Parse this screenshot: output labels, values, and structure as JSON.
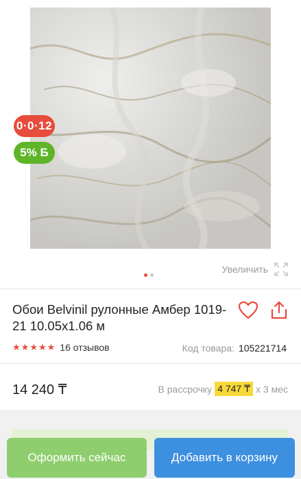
{
  "gallery": {
    "badge_installment": "0·0·12",
    "badge_bonus": "5% Б",
    "zoom_label": "Увеличить",
    "pagination": {
      "count": 2,
      "active": 1
    }
  },
  "product": {
    "title": "Обои Belvinil рулонные Амбер 1019-21 10.05x1.06 м",
    "rating": 5,
    "reviews": "16 отзывов",
    "sku_label": "Код товара:",
    "sku_value": "105221714",
    "price": "14 240 ₸",
    "installment_prefix": "В рассрочку",
    "installment_amount": "4 747 ₸",
    "installment_suffix": "х 3 мес"
  },
  "actions": {
    "order_now": "Оформить сейчас",
    "add_to_cart": "Добавить в корзину"
  },
  "colors": {
    "accent_red": "#e74c3c",
    "bonus_green": "#5eb528",
    "order_button": "#8fce6e",
    "cart_button": "#3d8fe0",
    "installment_highlight": "#f7d83a"
  }
}
